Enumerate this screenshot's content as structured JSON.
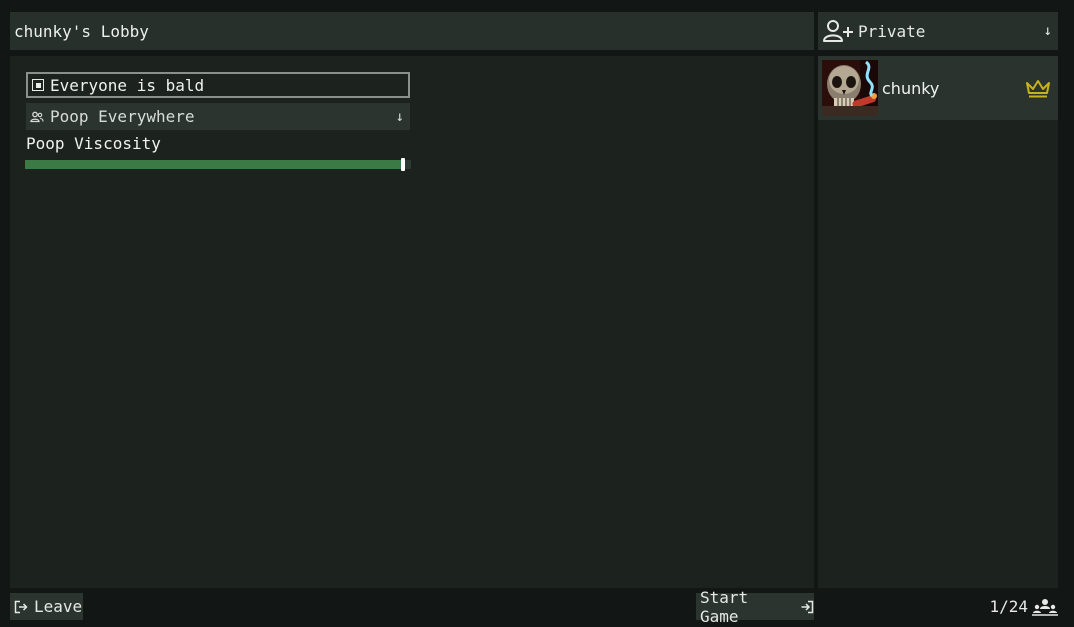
{
  "lobby": {
    "title": "chunky's Lobby"
  },
  "settings": {
    "toggle": {
      "label": "Everyone is bald",
      "checked": true,
      "icon": "checkbox-icon"
    },
    "dropdown": {
      "label": "Poop Everywhere",
      "icon": "people-icon",
      "arrow": "↓"
    },
    "slider": {
      "label": "Poop Viscosity",
      "value_fraction": 0.98,
      "fill_color": "#3c7a45"
    }
  },
  "privacy": {
    "label": "Private",
    "icon": "add-user-icon",
    "arrow": "↓"
  },
  "players": [
    {
      "name": "chunky",
      "is_host": true,
      "host_icon": "crown-icon",
      "host_color": "#c8b21c"
    }
  ],
  "footer": {
    "leave_label": "Leave",
    "start_label": "Start Game",
    "player_count": "1/24"
  }
}
